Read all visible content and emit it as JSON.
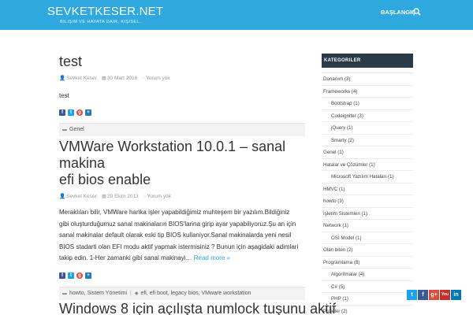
{
  "header": {
    "site_title": "SEVKETKESER.NET",
    "tagline": "BILIŞIM VE HAYATA DAIR, KIŞISEL..",
    "nav_home": "BAŞLANGIÇ",
    "search_icon": "search-icon",
    "brand_color": "#2fa8df"
  },
  "posts": [
    {
      "title": "test",
      "author": "Sevket Keser",
      "date": "30 Mart 2016",
      "comments": "Yorum yok",
      "excerpt": "test",
      "category": "Genel"
    },
    {
      "title_line1": "VMWare Workstation 10.0.1 – sanal makina",
      "title_line2": "efi bios enable",
      "author": "Sevket Keser",
      "date": "29 Ekim 2013",
      "comments": "Yorum yok",
      "excerpt_lines": [
        "Meraklıları bilir, VMWare harika işler yapabildiğimiz muhteşem bir yazılım.Bildiğiniz",
        "gibi oluşturduğumuz sanal makinaların BIOS'larina girip ayar yapabiliyoruz.Şu an için",
        "sanal makinalar default olarak eski tip BIOS kullaniyor.Sanal makinalarda yeni nesil",
        "BIOS stadarti olan EFI modu aktif yapmak istermisiniz ? Bunun için aşagidaki adimlari",
        "takip edin. 1-Her zamanki gibi sanal makinayi… "
      ],
      "read_more": "Read more »",
      "categories": "howto, Sistem Yönetimi",
      "tags": "efi, efi boot, legacy bios, VMware workstation"
    },
    {
      "title": "Windows 8 için açılışta numlock tuşunu aktif"
    }
  ],
  "sidebar": {
    "heading": "KATEGORILER",
    "categories": [
      {
        "label": "Donanım (3)",
        "sub": []
      },
      {
        "label": "Frameworks (4)",
        "sub": [
          "Bootstrap (1)",
          "Codeigniter (3)",
          "jQuery (1)",
          "Smarty (2)"
        ]
      },
      {
        "label": "Genel (1)",
        "sub": []
      },
      {
        "label": "Hatalar ve Çözümler (1)",
        "sub": [
          "Microsoft Yazılım Hataları (1)"
        ]
      },
      {
        "label": "HMVC (1)",
        "sub": []
      },
      {
        "label": "howto (3)",
        "sub": []
      },
      {
        "label": "İşletim Sistemleri (1)",
        "sub": []
      },
      {
        "label": "Network (1)",
        "sub": [
          "OSI Model (1)"
        ]
      },
      {
        "label": "Olan biten (2)",
        "sub": []
      },
      {
        "label": "Programlama (8)",
        "sub": [
          "Algoritmalar (4)",
          "C# (5)",
          "PHP (1)"
        ]
      },
      {
        "label": "Projeler (2)",
        "sub": []
      }
    ]
  },
  "social_colors": {
    "twitter": "#1da1f2",
    "facebook": "#3b5998",
    "googleplus": "#dd4b39",
    "youtube": "#c4302b",
    "linkedin": "#0077b5"
  }
}
